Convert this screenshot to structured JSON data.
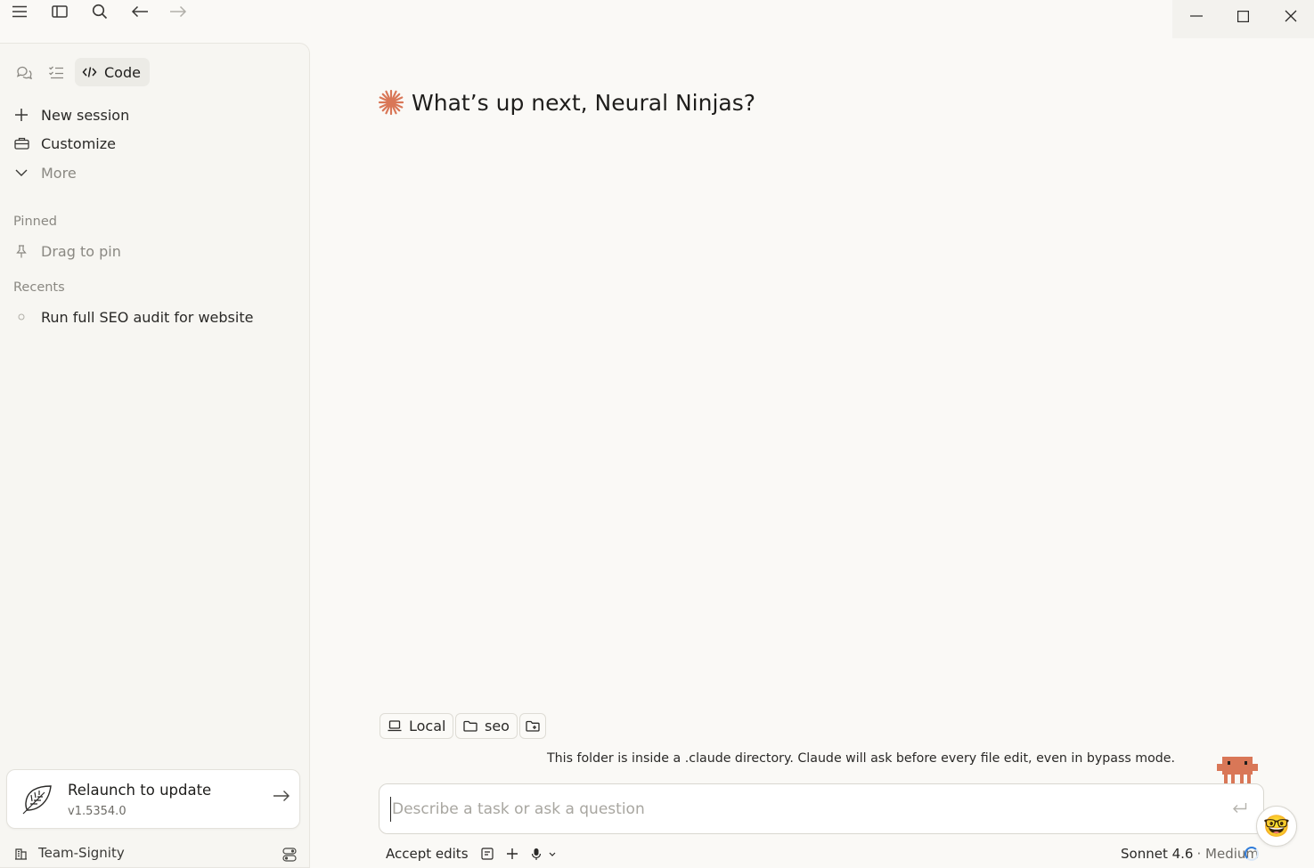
{
  "sidebar": {
    "active_mode_label": "Code",
    "nav": [
      {
        "label": "New session",
        "icon": "plus-icon"
      },
      {
        "label": "Customize",
        "icon": "briefcase-icon"
      },
      {
        "label": "More",
        "icon": "chevron-down-icon"
      }
    ],
    "pinned_label": "Pinned",
    "pin_placeholder": "Drag to pin",
    "recents_label": "Recents",
    "recents": [
      {
        "label": "Run full SEO audit for website"
      }
    ],
    "update": {
      "title": "Relaunch to update",
      "version": "v1.5354.0"
    },
    "team": "Team-Signity"
  },
  "main": {
    "greeting": "What’s up next, Neural Ninjas?",
    "chips": {
      "environment": "Local",
      "folder": "seo"
    },
    "notice": "This folder is inside a .claude directory. Claude will ask before every file edit, even in bypass mode.",
    "input": {
      "placeholder": "Describe a task or ask a question",
      "value": ""
    },
    "emoji_button": "🤓",
    "toolbar": {
      "mode_label": "Accept edits"
    },
    "model": {
      "name": "Sonnet 4.6",
      "effort": "· Medium"
    }
  },
  "colors": {
    "accent": "#d97757",
    "background": "#faf9f6",
    "sidebar_bg": "#f7f6f2"
  }
}
